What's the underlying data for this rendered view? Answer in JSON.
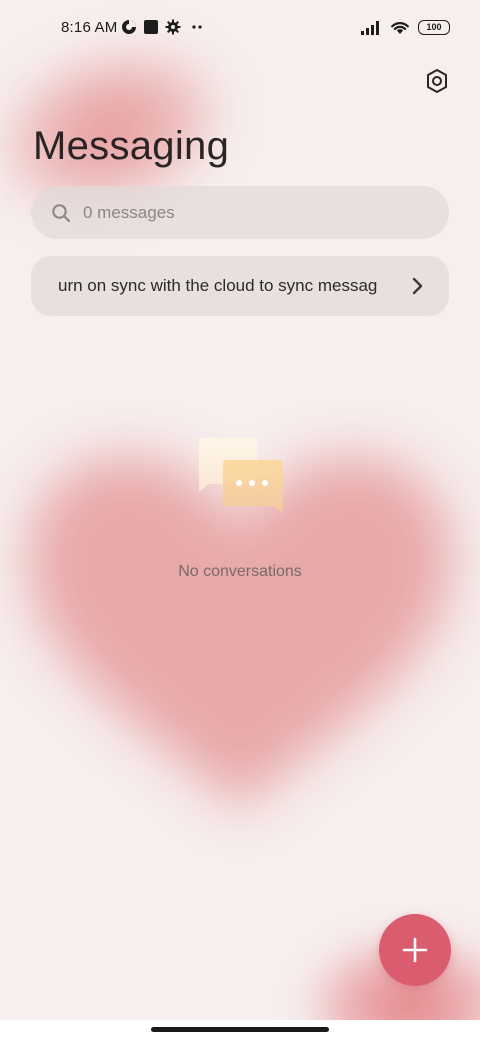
{
  "status_bar": {
    "time": "8:16 AM",
    "battery": "100",
    "left_icons": [
      "data-saver-icon",
      "notification-square-icon",
      "settings-gear-icon",
      "more-dots-icon"
    ],
    "right_icons": [
      "signal-icon",
      "wifi-icon",
      "battery-icon"
    ]
  },
  "header": {
    "title": "Messaging",
    "settings_icon": "settings-hexagon-icon"
  },
  "search": {
    "placeholder": "0 messages",
    "icon": "search-icon"
  },
  "sync_banner": {
    "text": "urn on sync with the cloud to sync messag",
    "icon": "chevron-right-icon"
  },
  "empty_state": {
    "illustration": "chat-bubbles-icon",
    "text": "No conversations"
  },
  "fab": {
    "icon": "plus-icon",
    "color": "#d95d6e"
  },
  "colors": {
    "background": "#f7eeee",
    "accent": "#d95d6e",
    "heart": "#e7a0a0"
  }
}
